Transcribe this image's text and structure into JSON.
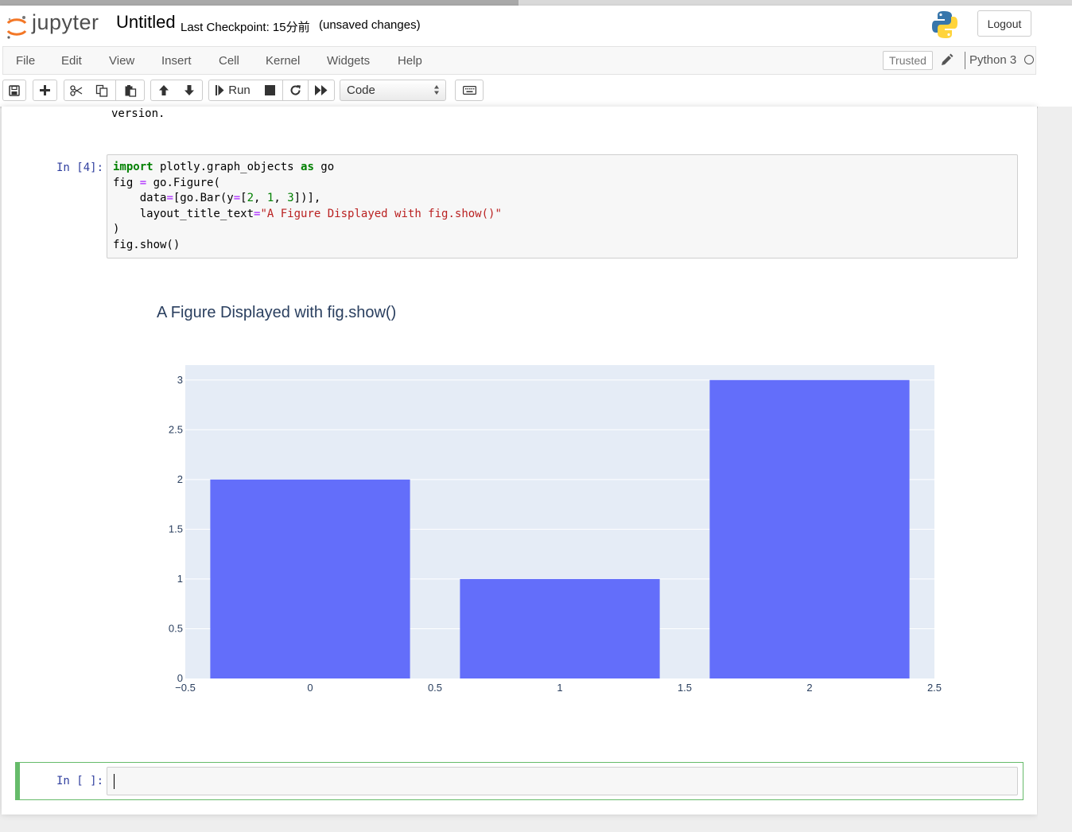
{
  "header": {
    "logo_text": "jupyter",
    "notebook_name": "Untitled",
    "checkpoint": "Last Checkpoint: 15分前",
    "unsaved": "(unsaved changes)",
    "logout": "Logout"
  },
  "menu": {
    "items": [
      "File",
      "Edit",
      "View",
      "Insert",
      "Cell",
      "Kernel",
      "Widgets",
      "Help"
    ],
    "trusted": "Trusted",
    "kernel": "Python 3"
  },
  "toolbar": {
    "run_label": "Run",
    "cell_type": "Code",
    "buttons": [
      "save-icon",
      "plus-icon",
      "cut-icon",
      "copy-icon",
      "paste-icon",
      "arrow-up-icon",
      "arrow-down-icon",
      "run-icon",
      "stop-icon",
      "restart-icon",
      "fast-forward-icon",
      "keyboard-icon"
    ]
  },
  "cells": {
    "previous_output": "version.",
    "code_cell": {
      "prompt": "In [4]:",
      "lines": [
        "import plotly.graph_objects as go",
        "fig = go.Figure(",
        "    data=[go.Bar(y=[2, 1, 3])],",
        "    layout_title_text=\"A Figure Displayed with fig.show()\"",
        ")",
        "fig.show()"
      ]
    },
    "empty_cell": {
      "prompt": "In [ ]:"
    }
  },
  "chart_data": {
    "type": "bar",
    "title": "A Figure Displayed with fig.show()",
    "x": [
      0,
      1,
      2
    ],
    "values": [
      2,
      1,
      3
    ],
    "xlim": [
      -0.5,
      2.5
    ],
    "ylim": [
      0,
      3.15
    ],
    "xticks": [
      "−0.5",
      "0",
      "0.5",
      "1",
      "1.5",
      "2",
      "2.5"
    ],
    "yticks": [
      "0",
      "0.5",
      "1",
      "1.5",
      "2",
      "2.5",
      "3"
    ],
    "bar_color": "#636efa",
    "plot_bg": "#e5ecf6",
    "grid": true
  },
  "colors": {
    "prompt": "#303f9f",
    "selected_border": "#66bb6a",
    "keyword": "#008000",
    "string": "#ba2121",
    "operator": "#aa22ff"
  }
}
